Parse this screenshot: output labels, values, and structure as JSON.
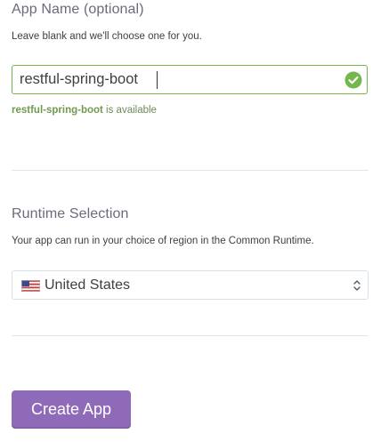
{
  "app_name": {
    "title": "App Name (optional)",
    "help": "Leave blank and we'll choose one for you.",
    "value": "restful-spring-boot",
    "status_icon": "check-circle-icon",
    "availability_name": "restful-spring-boot",
    "availability_suffix": " is available"
  },
  "runtime": {
    "title": "Runtime Selection",
    "help": "Your app can run in your choice of region in the Common Runtime.",
    "selected_region": "United States",
    "flag_icon": "us-flag-icon",
    "select_icon": "chevron-up-down-icon"
  },
  "actions": {
    "create_label": "Create App"
  },
  "colors": {
    "accent": "#8e6ab8",
    "success": "#74b84d",
    "success_text": "#6f9a50"
  }
}
